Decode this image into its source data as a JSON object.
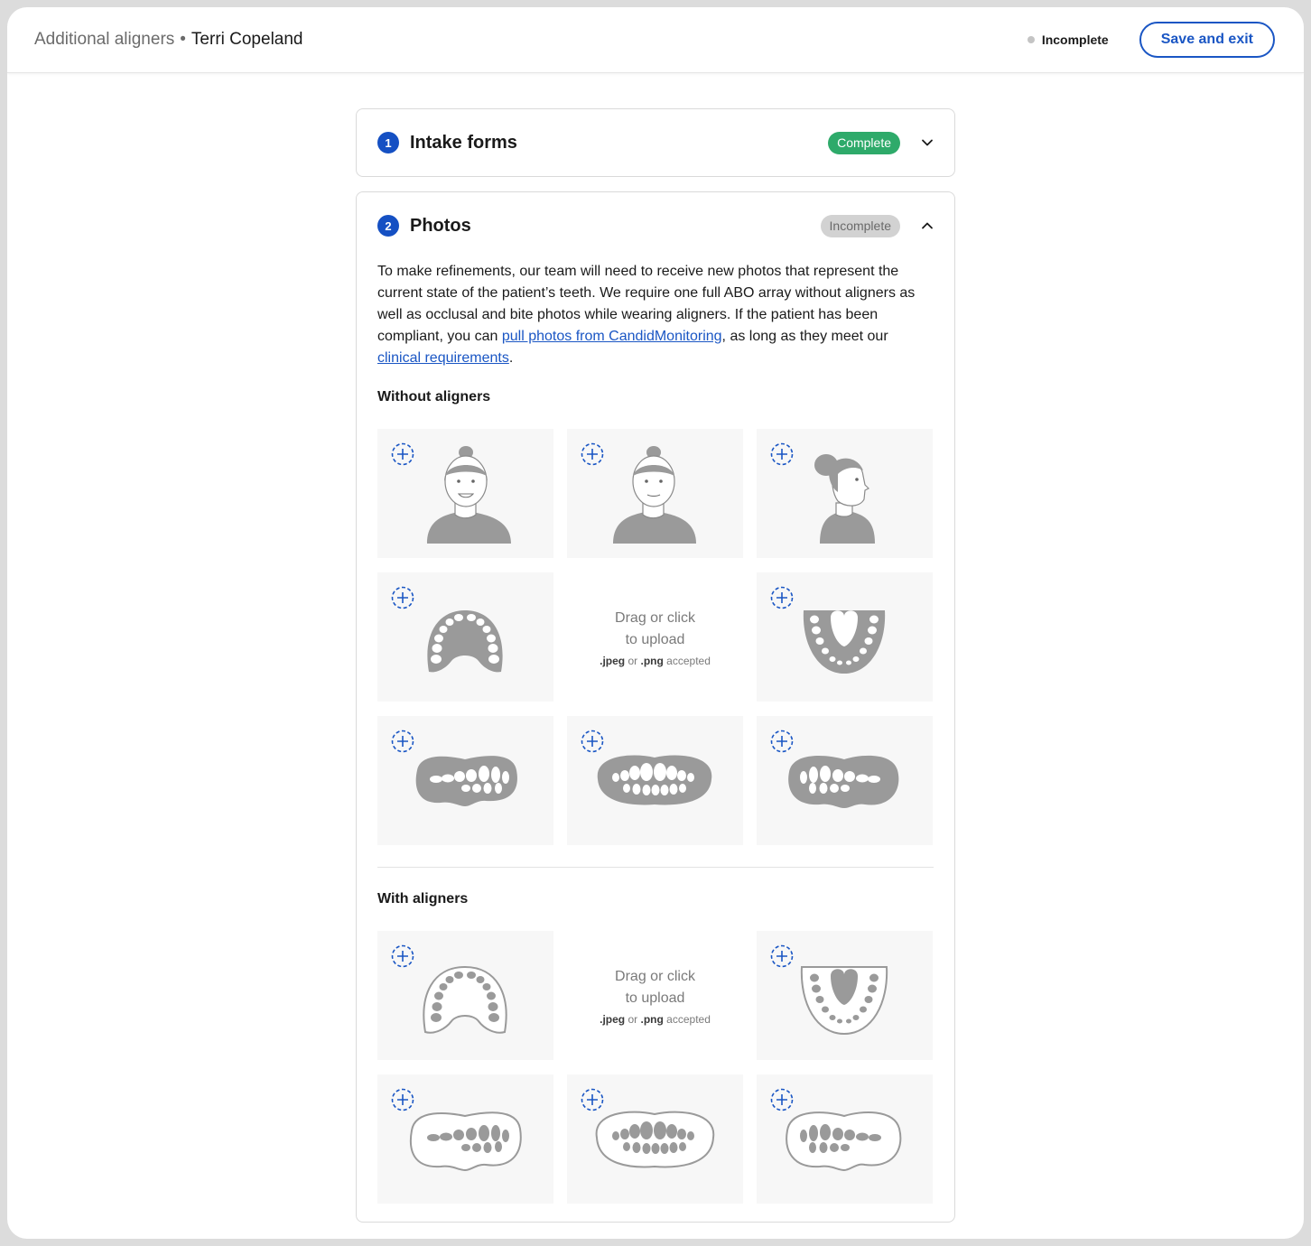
{
  "header": {
    "flow": "Additional aligners",
    "separator": "•",
    "patient": "Terri Copeland",
    "status": "Incomplete",
    "save_label": "Save and exit"
  },
  "sections": [
    {
      "number": "1",
      "title": "Intake forms",
      "status": "Complete",
      "expanded": false
    },
    {
      "number": "2",
      "title": "Photos",
      "status": "Incomplete",
      "expanded": true
    }
  ],
  "photos": {
    "desc_part1": "To make refinements, our team will need to receive new photos that represent the current state of the patient’s teeth. We require one full ABO array without aligners as well as occlusal and bite photos while wearing aligners. If the patient has been compliant, you can ",
    "link1": "pull photos from CandidMonitoring",
    "desc_part2": ", as long as they meet our ",
    "link2": "clinical requirements",
    "desc_part3": ".",
    "without_title": "Without aligners",
    "with_title": "With aligners",
    "upload": {
      "line1": "Drag or click",
      "line2": "to upload",
      "fmt1": ".jpeg",
      "or": "or",
      "fmt2": ".png",
      "accepted": "accepted"
    }
  },
  "colors": {
    "accent": "#1a56c4",
    "complete": "#2eaa6a",
    "incomplete": "#d2d2d2",
    "illustration": "#9a9a9a"
  },
  "icons": [
    "add-photo-icon",
    "chevron-down-icon",
    "chevron-up-icon"
  ]
}
